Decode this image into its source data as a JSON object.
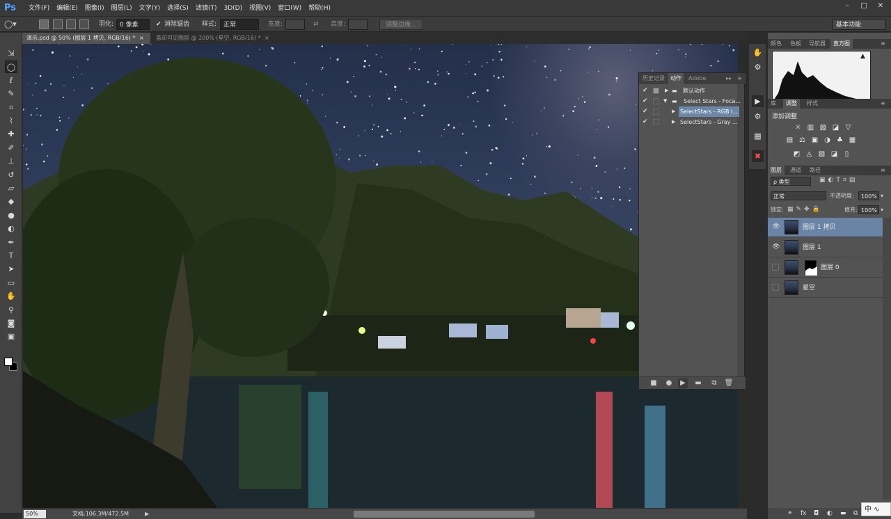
{
  "app": {
    "logo": "Ps",
    "menu": [
      "文件(F)",
      "编辑(E)",
      "图像(I)",
      "图层(L)",
      "文字(Y)",
      "选择(S)",
      "滤镜(T)",
      "3D(D)",
      "视图(V)",
      "窗口(W)",
      "帮助(H)"
    ],
    "window_controls": [
      "–",
      "□",
      "✕"
    ]
  },
  "options_bar": {
    "feather_label": "羽化:",
    "feather_value": "0 像素",
    "antialias_label": "消除锯齿",
    "style_label": "样式:",
    "style_value": "正常",
    "width_label": "宽度:",
    "height_label": "高度:",
    "refine_edge": "调整边缘...",
    "workspace": "基本功能"
  },
  "doc_tabs": [
    {
      "label": "演示.psd @ 50% (图层 1 拷贝, RGB/16) *",
      "close": "×",
      "active": true
    },
    {
      "label": "盖印可见图层 @ 200% (星空, RGB/16) *",
      "close": "×",
      "active": false
    }
  ],
  "tools": [
    {
      "name": "move-tool",
      "glyph": "⇲"
    },
    {
      "name": "elliptical-marquee-tool",
      "glyph": "◯",
      "active": true
    },
    {
      "name": "lasso-tool",
      "glyph": "ℓ"
    },
    {
      "name": "quick-selection-tool",
      "glyph": "✎"
    },
    {
      "name": "crop-tool",
      "glyph": "⌗"
    },
    {
      "name": "eyedropper-tool",
      "glyph": "⌇"
    },
    {
      "name": "healing-brush-tool",
      "glyph": "✚"
    },
    {
      "name": "brush-tool",
      "glyph": "✐"
    },
    {
      "name": "clone-stamp-tool",
      "glyph": "⊥"
    },
    {
      "name": "history-brush-tool",
      "glyph": "↺"
    },
    {
      "name": "eraser-tool",
      "glyph": "▱"
    },
    {
      "name": "paint-bucket-tool",
      "glyph": "◆"
    },
    {
      "name": "blur-tool",
      "glyph": "●"
    },
    {
      "name": "dodge-tool",
      "glyph": "◐"
    },
    {
      "name": "pen-tool",
      "glyph": "✒"
    },
    {
      "name": "type-tool",
      "glyph": "T"
    },
    {
      "name": "path-selection-tool",
      "glyph": "➤"
    },
    {
      "name": "rectangle-tool",
      "glyph": "▭"
    },
    {
      "name": "hand-tool",
      "glyph": "✋"
    },
    {
      "name": "zoom-tool",
      "glyph": "⚲"
    },
    {
      "name": "quick-mask-tool",
      "glyph": "◙"
    },
    {
      "name": "screen-mode-tool",
      "glyph": "▣"
    }
  ],
  "actions_panel": {
    "tabs": [
      "历史记录",
      "动作",
      "Adobe Co"
    ],
    "active_tab": 1,
    "rows": [
      {
        "label": "默认动作",
        "type": "folder",
        "expanded": false
      },
      {
        "label": "Select Stars - Foca...",
        "type": "folder",
        "expanded": true
      },
      {
        "label": "SelectStars - RGB I...",
        "type": "action",
        "selected": true
      },
      {
        "label": "SelectStars - Gray ...",
        "type": "action",
        "selected": false
      }
    ],
    "bottom_icons": [
      "■",
      "●",
      "▶",
      "▬",
      "⧉",
      "🗑"
    ]
  },
  "dock_icons": [
    "✋",
    "⚙",
    "▶",
    "⚙",
    "▦",
    "✖"
  ],
  "histogram_panel": {
    "tabs": [
      "颜色",
      "色板",
      "导航器",
      "直方图"
    ],
    "active_tab": 3,
    "warning": "▲"
  },
  "adjustments_panel": {
    "tabs": [
      "库",
      "调整",
      "样式"
    ],
    "active_tab": 1,
    "title": "添加调整",
    "row1": [
      "☼",
      "▥",
      "▨",
      "◪",
      "▽"
    ],
    "row2": [
      "▤",
      "⚖",
      "▣",
      "◑",
      "♣",
      "▦"
    ],
    "row3": [
      "◩",
      "◬",
      "▨",
      "◪",
      "▯"
    ]
  },
  "layers_panel": {
    "tabs": [
      "图层",
      "通道",
      "路径"
    ],
    "active_tab": 0,
    "filter_label": "ρ 类型",
    "blend_mode": "正常",
    "opacity_label": "不透明度:",
    "opacity_value": "100%",
    "lock_label": "锁定:",
    "fill_label": "填充:",
    "fill_value": "100%",
    "layers": [
      {
        "name": "图层 1 拷贝",
        "visible": true,
        "selected": true,
        "mask": false
      },
      {
        "name": "图层 1",
        "visible": true,
        "selected": false,
        "mask": false
      },
      {
        "name": "图层 0",
        "visible": false,
        "selected": false,
        "mask": true
      },
      {
        "name": "星空",
        "visible": false,
        "selected": false,
        "mask": false
      }
    ],
    "bottom_icons": [
      "⚭",
      "fx",
      "◘",
      "◐",
      "▬",
      "⧉",
      "🗑"
    ]
  },
  "status_bar": {
    "zoom": "50%",
    "doc_info": "文档:106.3M/472.5M",
    "arrow": "▶"
  },
  "ime": "中 ∿"
}
